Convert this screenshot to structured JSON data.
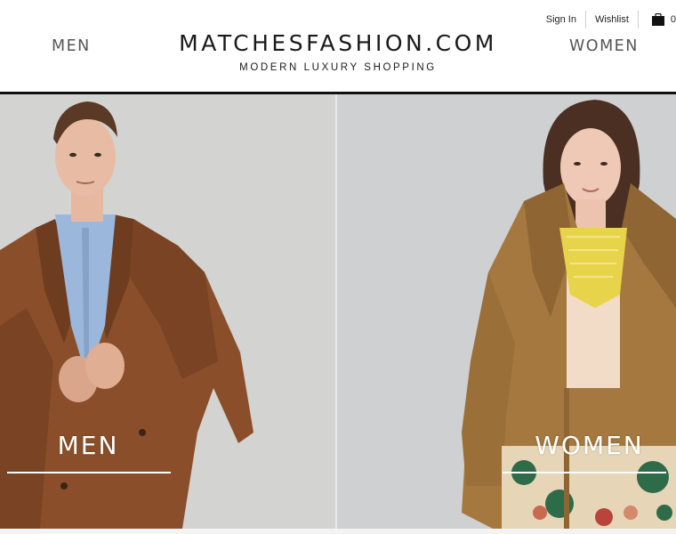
{
  "header": {
    "sign_in": "Sign In",
    "wishlist": "Wishlist",
    "bag_count": "0",
    "logo_title": "MATCHESFASHION.COM",
    "logo_subtitle": "MODERN LUXURY SHOPPING",
    "nav_men": "MEN",
    "nav_women": "WOMEN"
  },
  "hero": {
    "men_label": "MEN",
    "women_label": "WOMEN"
  },
  "icons": {
    "bag": "shopping-bag-icon"
  }
}
